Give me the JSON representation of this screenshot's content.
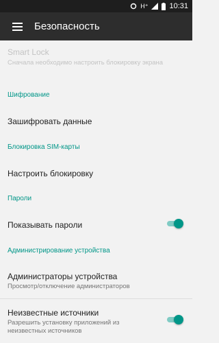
{
  "status_bar": {
    "network": "H⁺",
    "time": "10:31"
  },
  "app_bar": {
    "title": "Безопасность"
  },
  "smart_lock": {
    "title": "Smart Lock",
    "summary": "Сначала необходимо настроить блокировку экрана"
  },
  "encryption": {
    "header": "Шифрование",
    "encrypt_label": "Зашифровать данные"
  },
  "sim_lock": {
    "header": "Блокировка SIM-карты",
    "setup_label": "Настроить блокировку"
  },
  "passwords": {
    "header": "Пароли",
    "show_label": "Показывать пароли",
    "show_enabled": true
  },
  "device_admin": {
    "header": "Администрирование устройства",
    "admins_label": "Администраторы устройства",
    "admins_summary": "Просмотр/отключение администраторов",
    "unknown_label": "Неизвестные источники",
    "unknown_summary": "Разрешить установку приложений из неизвестных источников",
    "unknown_enabled": true
  },
  "colors": {
    "accent": "#009688",
    "toolbar": "#2d2d2d",
    "status_bar": "#1e1e1e",
    "background": "#f2f2f2"
  }
}
